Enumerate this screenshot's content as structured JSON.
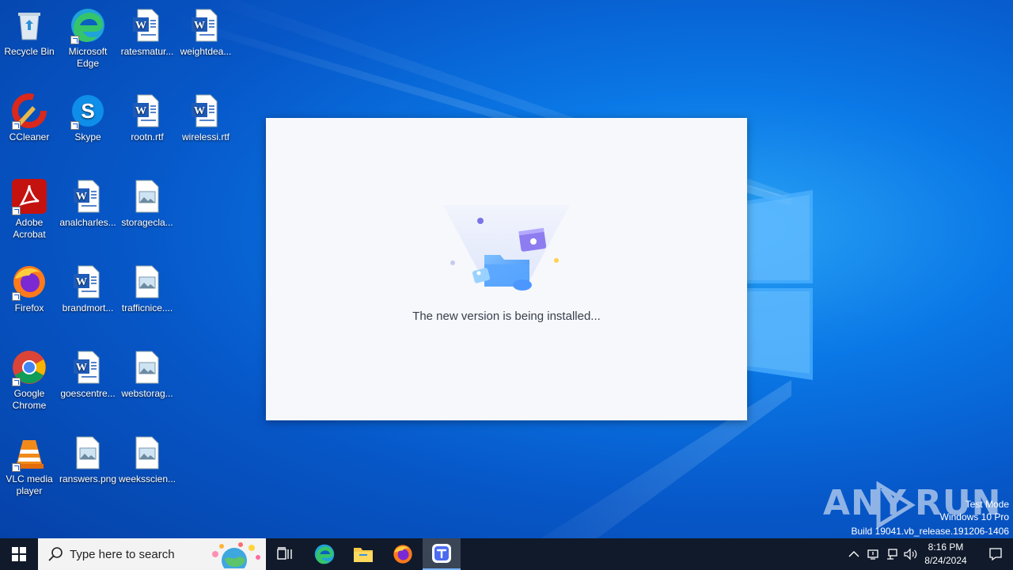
{
  "desktop": {
    "icons": [
      {
        "label": "Recycle Bin",
        "icon": "recycle-bin-icon"
      },
      {
        "label": "Microsoft Edge",
        "icon": "edge-icon"
      },
      {
        "label": "ratesmatur...",
        "icon": "word-document-icon"
      },
      {
        "label": "weightdea...",
        "icon": "word-document-icon"
      },
      {
        "label": "CCleaner",
        "icon": "ccleaner-icon"
      },
      {
        "label": "Skype",
        "icon": "skype-icon"
      },
      {
        "label": "rootn.rtf",
        "icon": "word-document-icon"
      },
      {
        "label": "wirelessi.rtf",
        "icon": "word-document-icon"
      },
      {
        "label": "Adobe Acrobat",
        "icon": "adobe-acrobat-icon"
      },
      {
        "label": "analcharles...",
        "icon": "word-document-icon"
      },
      {
        "label": "storagecla...",
        "icon": "image-file-icon"
      },
      {
        "label": "Firefox",
        "icon": "firefox-icon"
      },
      {
        "label": "brandmort...",
        "icon": "word-document-icon"
      },
      {
        "label": "trafficnice....",
        "icon": "image-file-icon"
      },
      {
        "label": "Google Chrome",
        "icon": "chrome-icon"
      },
      {
        "label": "goescentre...",
        "icon": "word-document-icon"
      },
      {
        "label": "webstorag...",
        "icon": "image-file-icon"
      },
      {
        "label": "VLC media player",
        "icon": "vlc-icon"
      },
      {
        "label": "ranswers.png",
        "icon": "image-file-icon"
      },
      {
        "label": "weeksscien...",
        "icon": "image-file-icon"
      }
    ]
  },
  "dialog": {
    "message": "The new version is being installed..."
  },
  "watermark": {
    "brand": "ANY RUN",
    "line1": "Test Mode",
    "line2": "Windows 10 Pro",
    "line3": "Build 19041.vb_release.191206-1406"
  },
  "taskbar": {
    "search_placeholder": "Type here to search",
    "apps": [
      {
        "name": "Task View",
        "icon": "task-view-icon"
      },
      {
        "name": "Microsoft Edge",
        "icon": "edge-icon"
      },
      {
        "name": "File Explorer",
        "icon": "folder-icon"
      },
      {
        "name": "Firefox",
        "icon": "firefox-icon"
      },
      {
        "name": "Installer",
        "icon": "installer-app-icon",
        "active": true
      }
    ],
    "clock_time": "8:16 PM",
    "clock_date": "8/24/2024"
  },
  "colors": {
    "desktop_blue": "#0a78e6",
    "taskbar": "#101a2b",
    "dialog_bg": "#f6f8fc",
    "dialog_text": "#3a3f4a"
  }
}
